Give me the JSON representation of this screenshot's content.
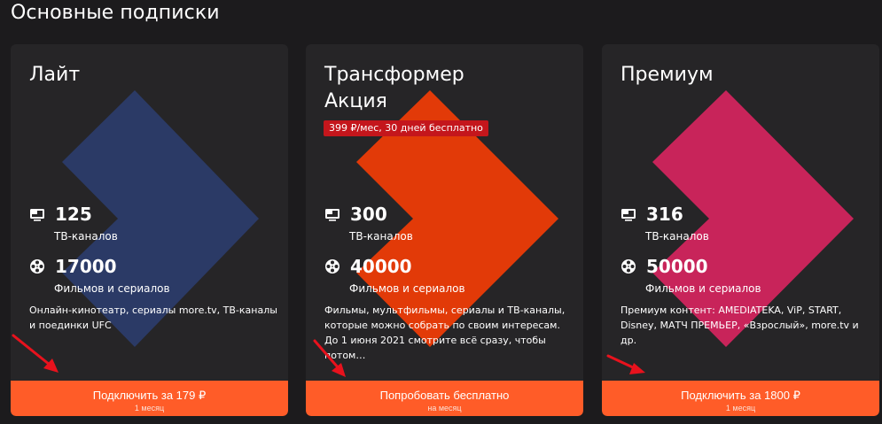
{
  "page": {
    "title": "Основные подписки"
  },
  "colors": {
    "background": "#1c1b1d",
    "card": "#262527",
    "accent_button": "#ff5c28",
    "promo_badge": "#c4161c",
    "chevron_lite": "#2b3a66",
    "chevron_transformer": "#e23a08",
    "chevron_premium": "#c8245a",
    "annotation_arrow": "#e8121d"
  },
  "plans": [
    {
      "title": "Лайт",
      "title_line2": "",
      "promo": "",
      "tv_count": "125",
      "tv_label": "ТВ-каналов",
      "films_count": "17000",
      "films_label": "Фильмов и сериалов",
      "description": "Онлайн-кинотеатр, сериалы more.tv, ТВ-каналы и поединки UFC",
      "cta_label": "Подключить за 179 ₽",
      "cta_sub": "1 месяц",
      "tv_icon": "tv-icon",
      "film_icon": "film-reel-icon"
    },
    {
      "title": "Трансформер",
      "title_line2": "Акция",
      "promo": "399 ₽/мес, 30 дней бесплатно",
      "tv_count": "300",
      "tv_label": "ТВ-каналов",
      "films_count": "40000",
      "films_label": "Фильмов и сериалов",
      "description": "Фильмы, мультфильмы, сериалы и ТВ-каналы, которые можно собрать по своим интересам. До 1 июня 2021 смотрите всё сразу, чтобы потом…",
      "cta_label": "Попробовать бесплатно",
      "cta_sub": "на месяц",
      "tv_icon": "tv-icon",
      "film_icon": "film-reel-icon"
    },
    {
      "title": "Премиум",
      "title_line2": "",
      "promo": "",
      "tv_count": "316",
      "tv_label": "ТВ-каналов",
      "films_count": "50000",
      "films_label": "Фильмов и сериалов",
      "description": "Премиум контент: AMEDIATEKA, ViP, START, Disney, МАТЧ ПРЕМЬЕР, «Взрослый», more.tv и др.",
      "cta_label": "Подключить за 1800 ₽",
      "cta_sub": "1 месяц",
      "tv_icon": "tv-icon",
      "film_icon": "film-reel-icon"
    }
  ]
}
